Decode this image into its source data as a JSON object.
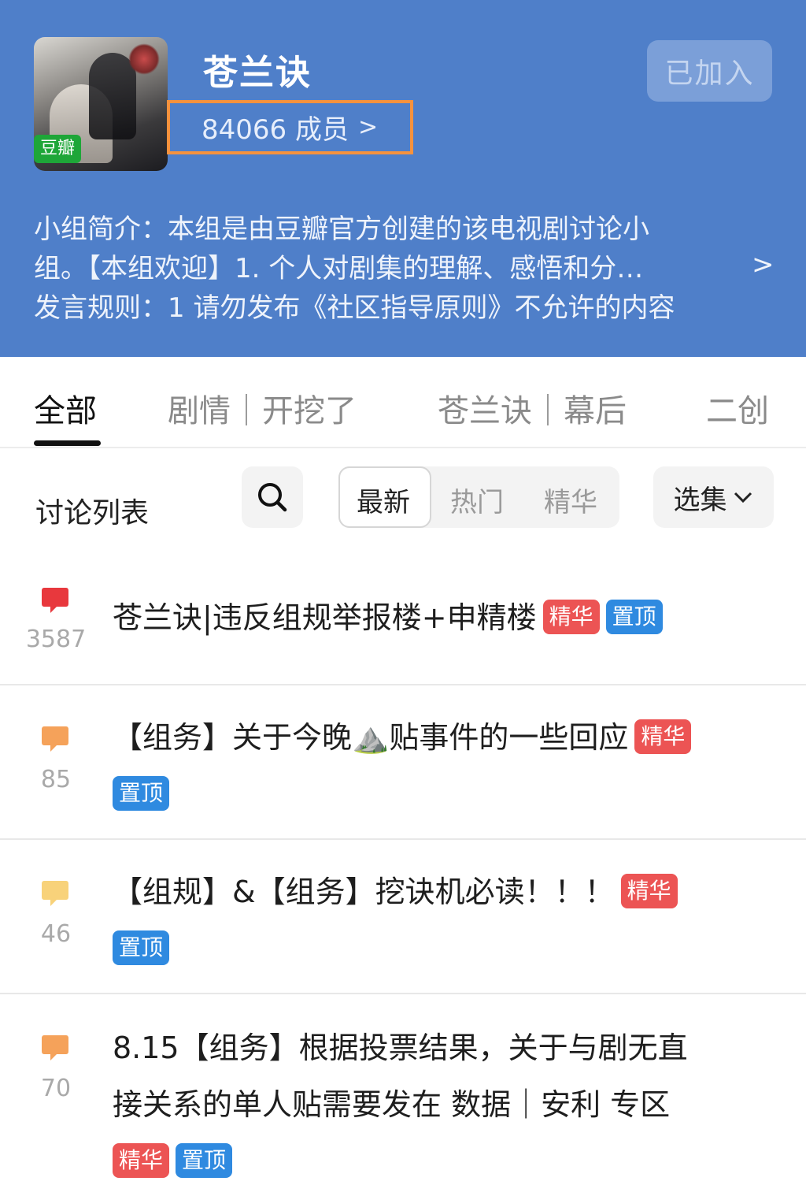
{
  "header": {
    "cover_badge": "豆瓣",
    "group_name": "苍兰诀",
    "member_count": "84066 成员",
    "member_chevron": ">",
    "join_label": "已加入",
    "intro_line1": "小组简介：本组是由豆瓣官方创建的该电视剧讨论小",
    "intro_line2": "组。【本组欢迎】1. 个人对剧集的理解、感悟和分…",
    "rules_line": "发言规则：1 请勿发布《社区指导原则》不允许的内容",
    "intro_chevron": ">"
  },
  "tabs": [
    {
      "label": "全部",
      "active": true
    },
    {
      "label": "剧情｜开挖了",
      "active": false
    },
    {
      "label": "苍兰诀｜幕后",
      "active": false
    },
    {
      "label": "二创",
      "active": false
    }
  ],
  "filters": {
    "list_label": "讨论列表",
    "sort_options": [
      "最新",
      "热门",
      "精华"
    ],
    "sort_selected": "最新",
    "episode_label": "选集"
  },
  "posts": [
    {
      "comments": "3587",
      "icon_color": "#e8383d",
      "line1": "苍兰诀|违反组规举报楼+申精楼",
      "tags": [
        "精华",
        "置顶"
      ]
    },
    {
      "comments": "85",
      "icon_color": "#f5a25a",
      "line1": "【组务】关于今晚⛰️贴事件的一些回应",
      "tags": [
        "精华",
        "置顶"
      ]
    },
    {
      "comments": "46",
      "icon_color": "#f8d27a",
      "line1": "【组规】&【组务】挖诀机必读！！！",
      "tags": [
        "精华",
        "置顶"
      ]
    },
    {
      "comments": "70",
      "icon_color": "#f5a25a",
      "line1": "8.15【组务】根据投票结果，关于与剧无直",
      "line2": "接关系的单人贴需要发在 数据｜安利 专区",
      "tags": [
        "精华",
        "置顶"
      ]
    }
  ]
}
